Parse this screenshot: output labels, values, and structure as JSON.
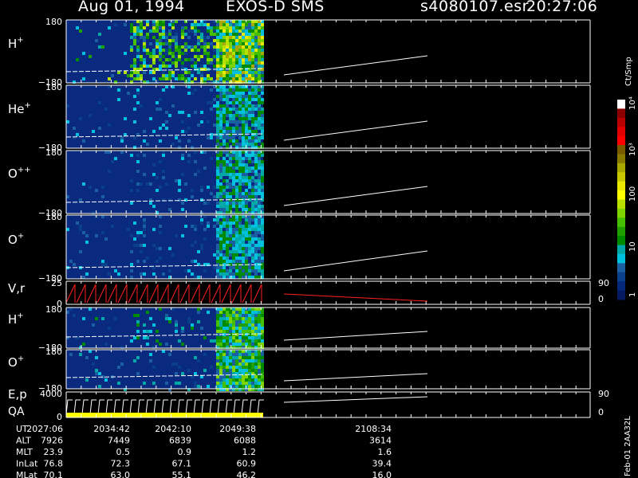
{
  "header": {
    "date": "Aug 01, 1994",
    "instrument": "EXOS-D SMS",
    "file": "s4080107.esr",
    "time": "20:27:06"
  },
  "panels": [
    {
      "label": "H",
      "sup": "+",
      "ytop": "180",
      "ybot": "−180"
    },
    {
      "label": "He",
      "sup": "+",
      "ytop": "180",
      "ybot": "−180"
    },
    {
      "label": "O",
      "sup": "++",
      "ytop": "180",
      "ybot": "−180"
    },
    {
      "label": "O",
      "sup": "+",
      "ytop": "180",
      "ybot": "−180"
    },
    {
      "label": "V,r",
      "sup": "",
      "ytop": "25",
      "ybot": "0",
      "rtop": "90",
      "rbot": "0"
    },
    {
      "label": "H",
      "sup": "+",
      "ytop": "180",
      "ybot": "−180"
    },
    {
      "label": "O",
      "sup": "+",
      "ytop": "180",
      "ybot": "−180"
    },
    {
      "label": "E,p",
      "sup": "",
      "ytop": "4000",
      "ybot": "0",
      "rtop": "90",
      "rbot": "0"
    }
  ],
  "qa_label": "QA",
  "colorbar": {
    "unit": "Ct/Smp",
    "ticks": [
      "10⁴",
      "10³",
      "100",
      "10",
      "1"
    ],
    "colors": [
      "#ffffff",
      "#8b0000",
      "#b80000",
      "#e00000",
      "#ff0000",
      "#7a5c00",
      "#8a7a00",
      "#a8a800",
      "#c8c800",
      "#e8e800",
      "#ffff00",
      "#b8e000",
      "#7fd400",
      "#44c000",
      "#20a000",
      "#008a00",
      "#00a8a8",
      "#00c0e0",
      "#1a5fa0",
      "#0a3f8a",
      "#06287a",
      "#031a60"
    ]
  },
  "footer": {
    "rows": [
      {
        "name": "UT",
        "values": [
          "2027:06",
          "2034:42",
          "2042:10",
          "2049:38",
          "2108:34"
        ]
      },
      {
        "name": "ALT",
        "values": [
          "7926",
          "7449",
          "6839",
          "6088",
          "3614"
        ]
      },
      {
        "name": "MLT",
        "values": [
          "23.9",
          "0.5",
          "0.9",
          "1.2",
          "1.6"
        ]
      },
      {
        "name": "InLat",
        "values": [
          "76.8",
          "72.3",
          "67.1",
          "60.9",
          "39.4"
        ]
      },
      {
        "name": "MLat",
        "values": [
          "70.1",
          "63.0",
          "55.1",
          "46.2",
          "16.0"
        ]
      }
    ],
    "stamp": "Feb-01  2AA32L"
  },
  "chart_data": {
    "type": "heatmap",
    "title": "Aug 01, 1994   EXOS-D SMS",
    "x_ticks_ut": [
      "2027:06",
      "2034:42",
      "2042:10",
      "2049:38",
      "2108:34"
    ],
    "series": [
      {
        "name": "H+",
        "ylim": [
          -180,
          180
        ]
      },
      {
        "name": "He+",
        "ylim": [
          -180,
          180
        ]
      },
      {
        "name": "O++",
        "ylim": [
          -180,
          180
        ]
      },
      {
        "name": "O+",
        "ylim": [
          -180,
          180
        ]
      },
      {
        "name": "V,r",
        "ylim": [
          0,
          25
        ],
        "right_ylim": [
          0,
          90
        ]
      },
      {
        "name": "H+",
        "ylim": [
          -180,
          180
        ]
      },
      {
        "name": "O+",
        "ylim": [
          -180,
          180
        ]
      },
      {
        "name": "E,p",
        "ylim": [
          0,
          4000
        ],
        "right_ylim": [
          0,
          90
        ]
      }
    ],
    "colorbar_unit": "Ct/Smp",
    "colorbar_ticks": [
      "1",
      "10",
      "100",
      "10³",
      "10⁴"
    ],
    "grid": false
  }
}
